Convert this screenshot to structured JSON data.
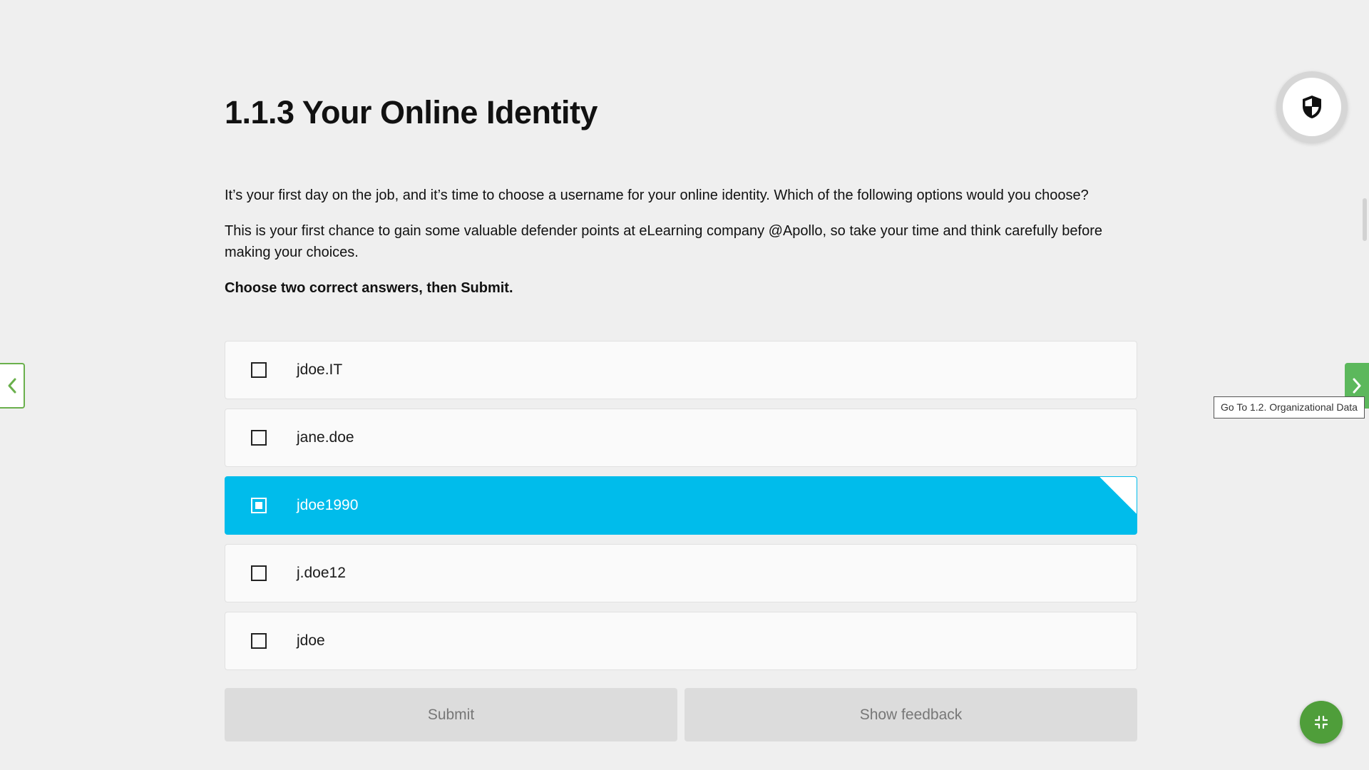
{
  "header": {
    "title": "1.1.3 Your Online Identity"
  },
  "content": {
    "paragraph1": "It’s your first day on the job, and it’s time to choose a username for your online identity. Which of the following options would you choose?",
    "paragraph2": "This is your first chance to gain some valuable defender points at eLearning company @Apollo, so take your time and think carefully before making your choices.",
    "instruction": "Choose two correct answers, then Submit."
  },
  "options": [
    {
      "label": "jdoe.IT",
      "selected": false
    },
    {
      "label": "jane.doe",
      "selected": false
    },
    {
      "label": "jdoe1990",
      "selected": true
    },
    {
      "label": "j.doe12",
      "selected": false
    },
    {
      "label": "jdoe",
      "selected": false
    }
  ],
  "buttons": {
    "submit": "Submit",
    "show_feedback": "Show feedback"
  },
  "navigation": {
    "next_tooltip": "Go To 1.2. Organizational Data"
  },
  "icons": {
    "shield": "shield-icon",
    "prev": "chevron-left-icon",
    "next": "chevron-right-icon",
    "collapse": "collapse-icon"
  },
  "colors": {
    "selected_option": "#00bceb",
    "nav_green": "#5cb85c",
    "fab_green": "#4f9e3a"
  }
}
